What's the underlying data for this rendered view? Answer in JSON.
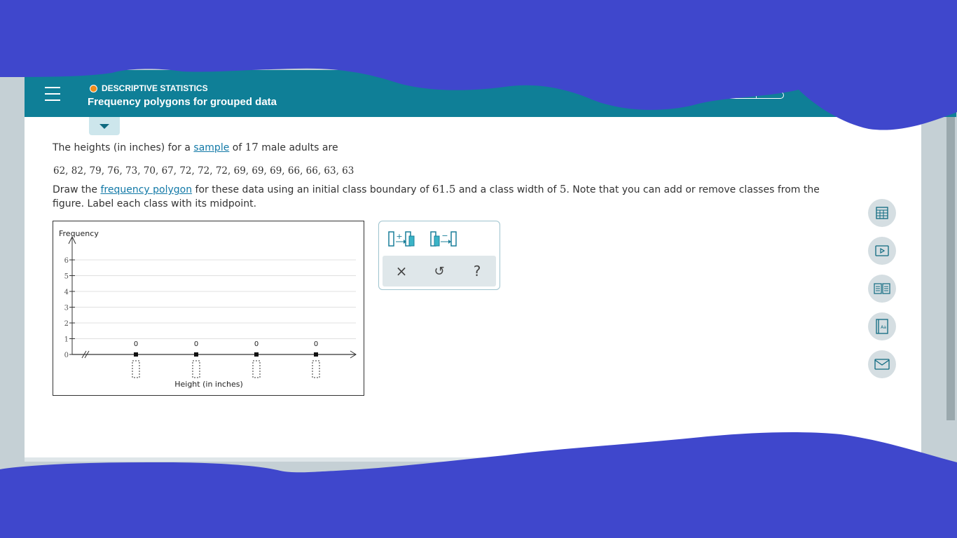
{
  "header": {
    "topic": "DESCRIPTIVE STATISTICS",
    "title": "Frequency polygons for grouped data",
    "progress_segments": 2
  },
  "problem": {
    "intro_before_link": "The heights (in inches) for a ",
    "intro_link": "sample",
    "intro_mid": " of ",
    "intro_count": "17",
    "intro_after": " male adults are",
    "data_values": "62, 82, 79, 76, 73, 70, 67, 72, 72, 72, 69, 69, 69, 66, 66, 63, 63",
    "instr_before_link": "Draw the ",
    "instr_link": "frequency polygon",
    "instr_mid1": " for these data using an initial class boundary of ",
    "instr_boundary": "61.5",
    "instr_mid2": " and a class width of ",
    "instr_width": "5",
    "instr_after": ". Note that you can add or remove classes from the",
    "instr_line2": "figure. Label each class with its midpoint."
  },
  "graph": {
    "y_axis_label": "Frequency",
    "x_axis_label": "Height (in inches)",
    "y_ticks": [
      "0",
      "1",
      "2",
      "3",
      "4",
      "5",
      "6"
    ],
    "point_values": [
      "0",
      "0",
      "0",
      "0"
    ]
  },
  "chart_data": {
    "type": "line",
    "title": "",
    "xlabel": "Height (in inches)",
    "ylabel": "Frequency",
    "ylim": [
      0,
      6
    ],
    "categories": [
      "",
      "",
      "",
      ""
    ],
    "values": [
      0,
      0,
      0,
      0
    ],
    "grid": true
  },
  "tools": {
    "add_class_icon": "add-class-icon",
    "remove_class_icon": "remove-class-icon",
    "clear": "×",
    "undo": "↺",
    "help": "?"
  },
  "side_buttons": [
    "calculator-icon",
    "video-icon",
    "textbook-icon",
    "glossary-icon",
    "mail-icon"
  ],
  "colors": {
    "header_bg": "#0f7f97",
    "accent_dot": "#f08c1a",
    "link": "#1279a7",
    "overlay": "#3f47cc"
  }
}
